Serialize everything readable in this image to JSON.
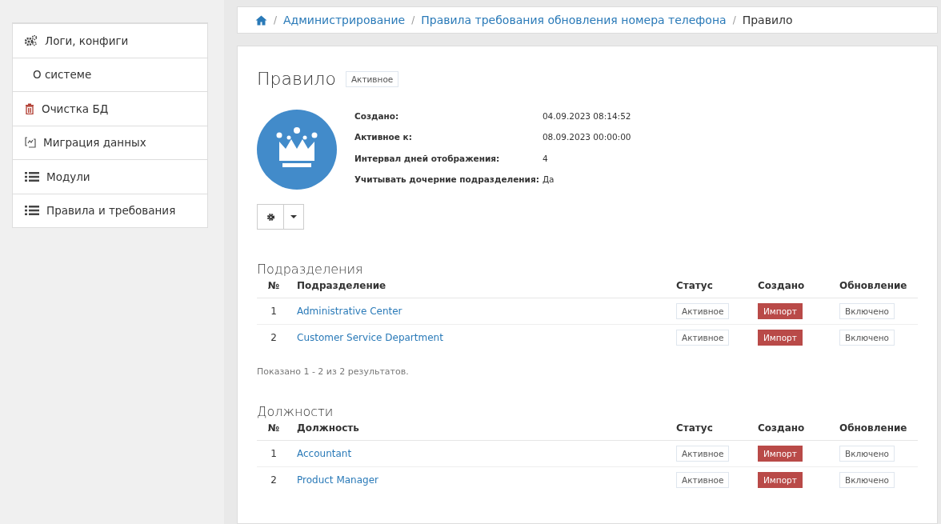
{
  "sidebar": {
    "items": [
      {
        "label": "Логи, конфиги",
        "kind": "gears"
      },
      {
        "label": "О системе",
        "kind": "plain"
      },
      {
        "label": "Очистка БД",
        "kind": "trash"
      },
      {
        "label": "Миграция данных",
        "kind": "migration"
      },
      {
        "label": "Модули",
        "kind": "list"
      },
      {
        "label": "Правила и требования",
        "kind": "list"
      }
    ]
  },
  "breadcrumb": [
    {
      "kind": "home"
    },
    {
      "kind": "separator",
      "text": "/"
    },
    {
      "kind": "link",
      "text": "Администрирование"
    },
    {
      "kind": "separator",
      "text": "/"
    },
    {
      "kind": "link",
      "text": "Правила требования обновления номера телефона"
    },
    {
      "kind": "separator",
      "text": "/"
    },
    {
      "kind": "current",
      "text": "Правило"
    }
  ],
  "rule": {
    "title": "Правило",
    "status": "Активное",
    "details": [
      {
        "label": "Создано:",
        "value": "04.09.2023 08:14:52"
      },
      {
        "label": "Активное к:",
        "value": "08.09.2023 00:00:00"
      },
      {
        "label": "Интервал дней отображения:",
        "value": "4"
      },
      {
        "label": "Учитывать дочерние подразделения:",
        "value": "Да"
      }
    ]
  },
  "sections": [
    {
      "title": "Подразделения",
      "columns": [
        "№",
        "Подразделение",
        "Статус",
        "Создано",
        "Обновление"
      ],
      "rows": [
        {
          "num": "1",
          "name": "Administrative Center",
          "status": "Активное",
          "created": "Импорт",
          "update": "Включено"
        },
        {
          "num": "2",
          "name": "Customer Service Department",
          "status": "Активное",
          "created": "Импорт",
          "update": "Включено"
        }
      ],
      "summary": "Показано 1 - 2 из 2 результатов."
    },
    {
      "title": "Должности",
      "columns": [
        "№",
        "Должность",
        "Статус",
        "Создано",
        "Обновление"
      ],
      "rows": [
        {
          "num": "1",
          "name": "Accountant",
          "status": "Активное",
          "created": "Импорт",
          "update": "Включено"
        },
        {
          "num": "2",
          "name": "Product Manager",
          "status": "Активное",
          "created": "Импорт",
          "update": "Включено"
        }
      ]
    }
  ]
}
